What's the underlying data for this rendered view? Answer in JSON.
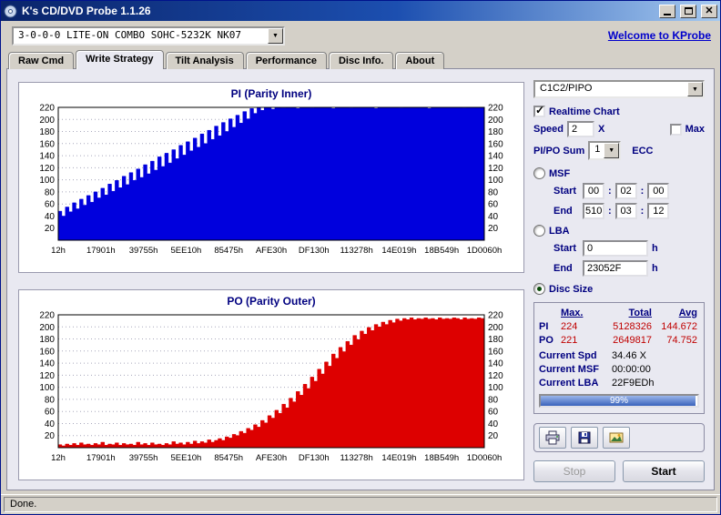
{
  "window": {
    "title": "K's CD/DVD Probe 1.1.26"
  },
  "toolbar": {
    "drive": "3-0-0-0 LITE-ON COMBO SOHC-5232K NK07",
    "link": "Welcome to KProbe"
  },
  "tabs": [
    "Raw Cmd",
    "Write Strategy",
    "Tilt Analysis",
    "Performance",
    "Disc Info.",
    "About"
  ],
  "active_tab": "Write Strategy",
  "chart_data": [
    {
      "type": "area",
      "title": "PI (Parity Inner)",
      "color": "#0000dd",
      "xlabel": "",
      "ylabel": "",
      "ylim": [
        0,
        220
      ],
      "grid": true,
      "y_ticks": [
        220,
        200,
        180,
        160,
        140,
        120,
        100,
        80,
        60,
        40,
        20
      ],
      "x_labels": [
        "12h",
        "17901h",
        "39755h",
        "5EE10h",
        "85475h",
        "AFE30h",
        "DF130h",
        "113278h",
        "14E019h",
        "18B549h",
        "1D0060h"
      ],
      "values": [
        48,
        40,
        55,
        47,
        62,
        52,
        68,
        58,
        74,
        63,
        80,
        70,
        86,
        75,
        93,
        81,
        99,
        87,
        106,
        92,
        112,
        99,
        118,
        104,
        125,
        110,
        131,
        116,
        138,
        122,
        144,
        128,
        150,
        135,
        157,
        141,
        163,
        148,
        169,
        154,
        176,
        160,
        182,
        167,
        189,
        173,
        195,
        180,
        201,
        187,
        207,
        194,
        213,
        201,
        218,
        210,
        220,
        215,
        220,
        220,
        217,
        220,
        220,
        219,
        220,
        220,
        220,
        218,
        220,
        220,
        220,
        219,
        220,
        220,
        220,
        220,
        220,
        218,
        220,
        220,
        220,
        220,
        219,
        220,
        220,
        220,
        220,
        220,
        220,
        218,
        220,
        220,
        220,
        220,
        220,
        220,
        219,
        220,
        220,
        220,
        220,
        220,
        220,
        220,
        218,
        220,
        220,
        220,
        220,
        220,
        220,
        220,
        220,
        220,
        219,
        220,
        220,
        220,
        220,
        220
      ]
    },
    {
      "type": "area",
      "title": "PO (Parity Outer)",
      "color": "#dd0000",
      "xlabel": "",
      "ylabel": "",
      "ylim": [
        0,
        220
      ],
      "grid": true,
      "y_ticks": [
        220,
        200,
        180,
        160,
        140,
        120,
        100,
        80,
        60,
        40,
        20
      ],
      "x_labels": [
        "12h",
        "17901h",
        "39755h",
        "5EE10h",
        "85475h",
        "AFE30h",
        "DF130h",
        "113278h",
        "14E019h",
        "18B549h",
        "1D0060h"
      ],
      "values": [
        5,
        3,
        6,
        4,
        7,
        4,
        8,
        5,
        6,
        4,
        7,
        5,
        9,
        4,
        6,
        5,
        8,
        4,
        7,
        5,
        6,
        4,
        9,
        5,
        7,
        4,
        8,
        5,
        6,
        4,
        7,
        5,
        10,
        6,
        8,
        5,
        9,
        6,
        11,
        7,
        10,
        8,
        13,
        9,
        12,
        15,
        12,
        18,
        16,
        22,
        20,
        27,
        24,
        32,
        29,
        38,
        34,
        45,
        41,
        53,
        49,
        62,
        57,
        72,
        66,
        82,
        76,
        93,
        87,
        105,
        98,
        117,
        110,
        130,
        122,
        142,
        135,
        155,
        148,
        166,
        159,
        176,
        170,
        186,
        179,
        193,
        188,
        199,
        194,
        204,
        200,
        208,
        204,
        211,
        207,
        213,
        210,
        214,
        212,
        215,
        212,
        214,
        213,
        215,
        213,
        214,
        212,
        215,
        213,
        214,
        213,
        215,
        214,
        212,
        215,
        213,
        214,
        213,
        215,
        214
      ]
    }
  ],
  "panel": {
    "mode_select": "C1C2/PIPO",
    "realtime_chart": {
      "label": "Realtime Chart",
      "checked": true
    },
    "speed": {
      "label": "Speed",
      "value": "2",
      "unit": "X",
      "max_label": "Max",
      "max_checked": false
    },
    "pipo_sum": {
      "label": "PI/PO Sum",
      "value": "1",
      "unit": "ECC"
    },
    "msf": {
      "label": "MSF",
      "selected": false,
      "start_label": "Start",
      "end_label": "End",
      "start": [
        "00",
        "02",
        "00"
      ],
      "end": [
        "510",
        "03",
        "12"
      ]
    },
    "lba": {
      "label": "LBA",
      "selected": false,
      "start_label": "Start",
      "end_label": "End",
      "start": "0",
      "end": "23052F",
      "unit": "h"
    },
    "disc_size": {
      "label": "Disc Size",
      "selected": true
    },
    "stats": {
      "headers": [
        "Max.",
        "Total",
        "Avg"
      ],
      "rows": [
        {
          "label": "PI",
          "max": "224",
          "total": "5128326",
          "avg": "144.672"
        },
        {
          "label": "PO",
          "max": "221",
          "total": "2649817",
          "avg": "74.752"
        }
      ],
      "current": [
        {
          "label": "Current Spd",
          "value": "34.46 X"
        },
        {
          "label": "Current MSF",
          "value": "00:00:00"
        },
        {
          "label": "Current LBA",
          "value": "22F9EDh"
        }
      ],
      "progress": "99%"
    },
    "icon_buttons": [
      "print-icon",
      "save-icon",
      "save-chart-image-icon"
    ],
    "buttons": {
      "stop": "Stop",
      "start": "Start"
    }
  },
  "status_bar": "Done."
}
